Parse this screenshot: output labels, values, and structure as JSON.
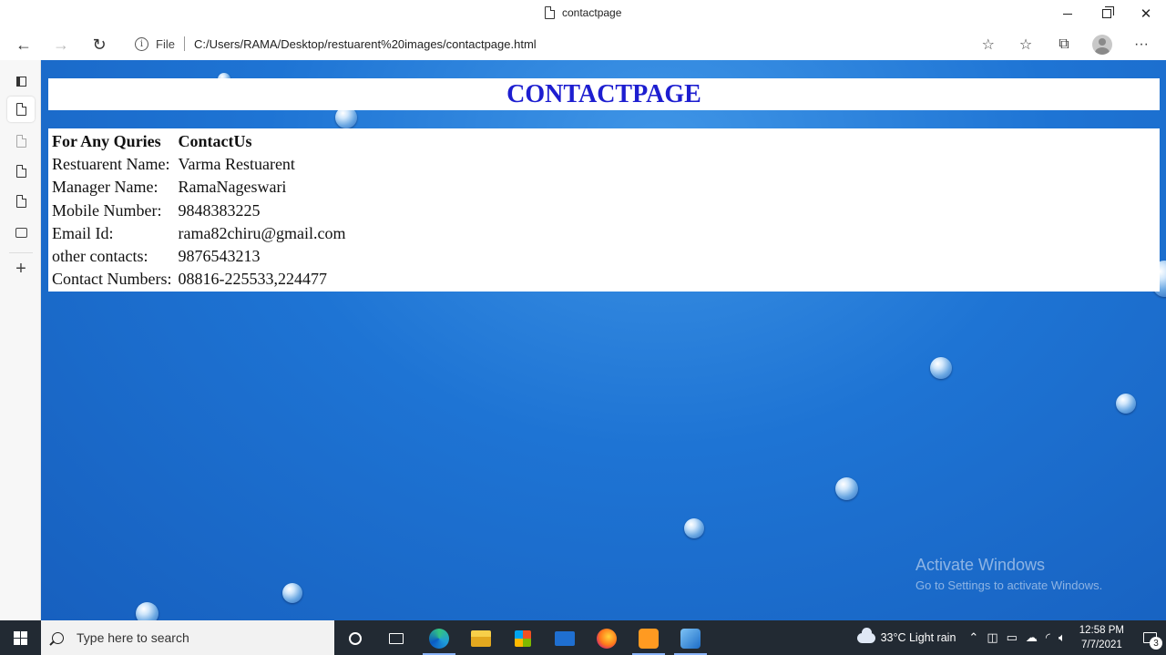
{
  "window": {
    "tab_title": "contactpage",
    "min_icon": "minimize-icon",
    "max_icon": "restore-icon",
    "close_glyph": "✕"
  },
  "toolbar": {
    "back_glyph": "←",
    "forward_glyph": "→",
    "reload_glyph": "↻",
    "info_glyph": "i",
    "file_label": "File",
    "url": "C:/Users/RAMA/Desktop/restuarent%20images/contactpage.html",
    "fav_add_glyph": "☆",
    "favorites_glyph": "☆",
    "collections_glyph": "⧉",
    "menu_glyph": "···"
  },
  "sidebar": {
    "items": [
      "tab-actions-icon",
      "page-tab-active",
      "page-tab",
      "page-tab-2",
      "page-tab-3",
      "page-tab-4"
    ],
    "new_tab_glyph": "+"
  },
  "page": {
    "title": "CONTACTPAGE",
    "table": {
      "headers": [
        "For Any Quries",
        "ContactUs"
      ],
      "rows": [
        [
          "Restuarent Name:",
          "Varma Restuarent"
        ],
        [
          "Manager Name:",
          "RamaNageswari"
        ],
        [
          "Mobile Number:",
          "9848383225"
        ],
        [
          "Email Id:",
          "rama82chiru@gmail.com"
        ],
        [
          "other contacts:",
          "9876543213"
        ],
        [
          "Contact Numbers:",
          "08816-225533,224477"
        ]
      ]
    },
    "watermark": {
      "title": "Activate Windows",
      "subtitle": "Go to Settings to activate Windows."
    },
    "colors": {
      "title": "#1d1ed0",
      "background": "#1e74d4"
    }
  },
  "taskbar": {
    "search_placeholder": "Type here to search",
    "weather": "33°C  Light rain",
    "time": "12:58 PM",
    "date": "7/7/2021",
    "notification_count": "3",
    "apps": [
      "task-view-icon",
      "widgets-icon",
      "edge-icon",
      "file-explorer-icon",
      "store-icon",
      "mail-icon",
      "firefox-icon",
      "sublime-text-icon",
      "photos-icon"
    ]
  }
}
